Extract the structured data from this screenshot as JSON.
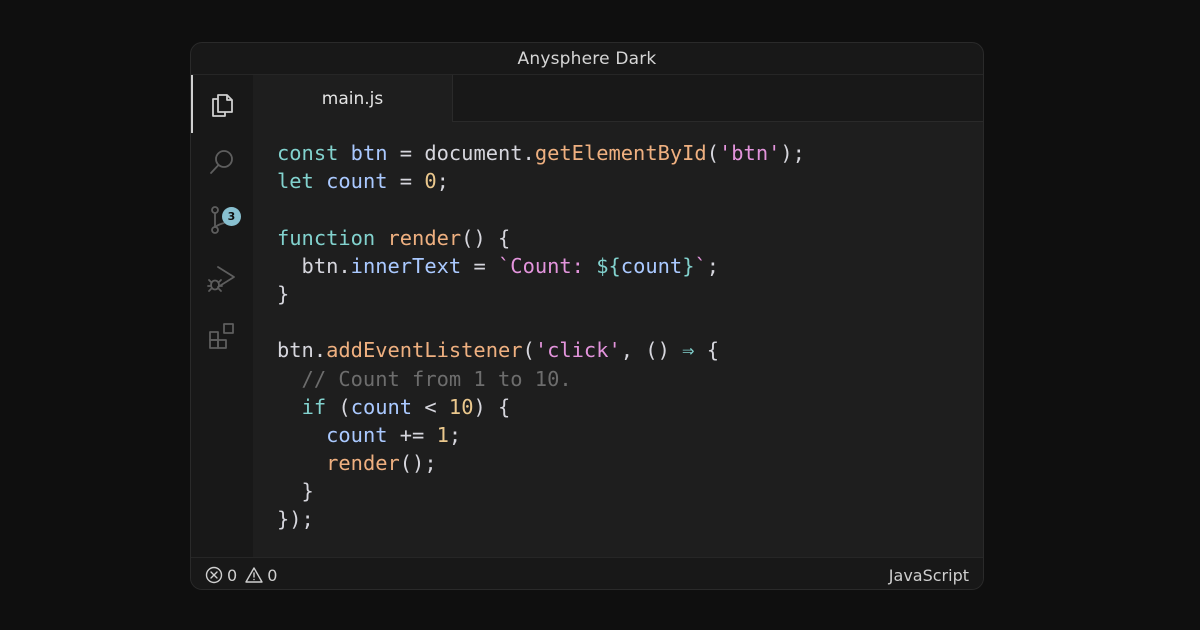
{
  "window": {
    "title": "Anysphere Dark"
  },
  "activity_bar": {
    "items": [
      {
        "name": "explorer",
        "icon": "files-icon",
        "active": true
      },
      {
        "name": "search",
        "icon": "search-icon"
      },
      {
        "name": "source-control",
        "icon": "source-control-icon",
        "badge": "3"
      },
      {
        "name": "run-debug",
        "icon": "run-debug-icon"
      },
      {
        "name": "extensions",
        "icon": "extensions-icon"
      }
    ]
  },
  "editor": {
    "tabs": [
      {
        "label": "main.js",
        "active": true
      }
    ],
    "lines": [
      [
        [
          "kw",
          "const"
        ],
        [
          "op",
          " "
        ],
        [
          "var",
          "btn"
        ],
        [
          "op",
          " = document."
        ],
        [
          "fn",
          "getElementById"
        ],
        [
          "op",
          "("
        ],
        [
          "str",
          "'btn'"
        ],
        [
          "op",
          ");"
        ]
      ],
      [
        [
          "kw",
          "let"
        ],
        [
          "op",
          " "
        ],
        [
          "var",
          "count"
        ],
        [
          "op",
          " = "
        ],
        [
          "num",
          "0"
        ],
        [
          "op",
          ";"
        ]
      ],
      [],
      [
        [
          "kw",
          "function"
        ],
        [
          "op",
          " "
        ],
        [
          "fn",
          "render"
        ],
        [
          "op",
          "() {"
        ]
      ],
      [
        [
          "op",
          "  btn."
        ],
        [
          "var",
          "innerText"
        ],
        [
          "op",
          " = "
        ],
        [
          "str",
          "`Count: "
        ],
        [
          "kw",
          "${"
        ],
        [
          "var",
          "count"
        ],
        [
          "kw",
          "}"
        ],
        [
          "str",
          "`"
        ],
        [
          "op",
          ";"
        ]
      ],
      [
        [
          "op",
          "}"
        ]
      ],
      [],
      [
        [
          "op",
          "btn."
        ],
        [
          "fn",
          "addEventListener"
        ],
        [
          "op",
          "("
        ],
        [
          "str",
          "'click'"
        ],
        [
          "op",
          ", () "
        ],
        [
          "arrow",
          "⇒"
        ],
        [
          "op",
          " {"
        ]
      ],
      [
        [
          "cmt",
          "  // Count from 1 to 10."
        ]
      ],
      [
        [
          "op",
          "  "
        ],
        [
          "kw",
          "if"
        ],
        [
          "op",
          " ("
        ],
        [
          "var",
          "count"
        ],
        [
          "op",
          " < "
        ],
        [
          "num",
          "10"
        ],
        [
          "op",
          ") {"
        ]
      ],
      [
        [
          "op",
          "    "
        ],
        [
          "var",
          "count"
        ],
        [
          "op",
          " += "
        ],
        [
          "num",
          "1"
        ],
        [
          "op",
          ";"
        ]
      ],
      [
        [
          "op",
          "    "
        ],
        [
          "fn",
          "render"
        ],
        [
          "op",
          "();"
        ]
      ],
      [
        [
          "op",
          "  }"
        ]
      ],
      [
        [
          "op",
          "});"
        ]
      ]
    ]
  },
  "status_bar": {
    "errors": "0",
    "warnings": "0",
    "language": "JavaScript"
  },
  "colors": {
    "background": "#0f0f0f",
    "editor_bg": "#1e1e1e",
    "keyword": "#82d2ce",
    "variable": "#aac9ff",
    "function": "#efb080",
    "string": "#e394dc",
    "number": "#ebc88d",
    "comment": "#6d6d6d",
    "badge": "#88c0d0"
  }
}
